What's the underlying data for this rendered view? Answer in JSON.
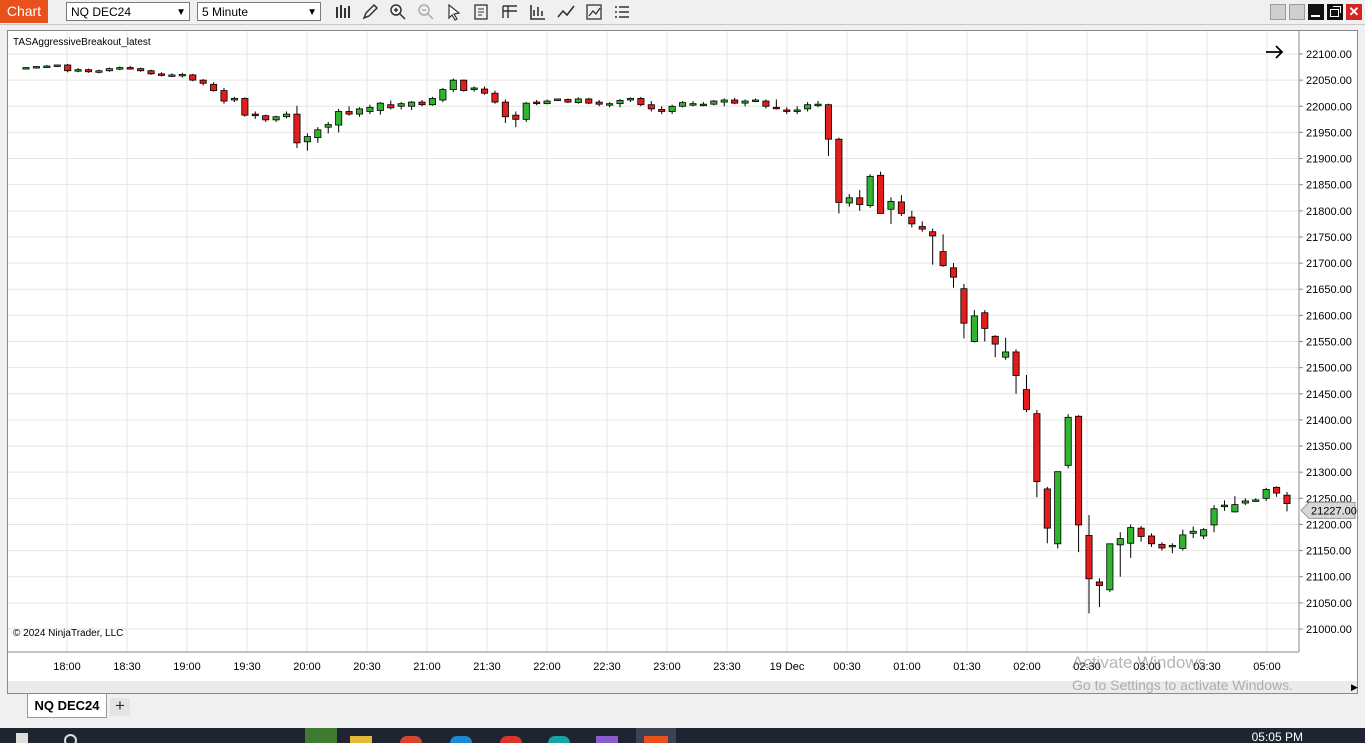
{
  "toolbar": {
    "chart_label": "Chart",
    "instrument": "NQ DEC24",
    "interval": "5 Minute",
    "icons": [
      "bar-type-icon",
      "draw-pencil-icon",
      "zoom-in-icon",
      "zoom-out-icon",
      "pointer-icon",
      "data-box-icon",
      "templates-icon",
      "properties-icon",
      "indicators-icon",
      "strategies-icon",
      "more-menu-icon"
    ]
  },
  "chart": {
    "strategy_label": "TASAggressiveBreakout_latest",
    "copyright": "© 2024 NinjaTrader, LLC",
    "current_price_label": "21227.00",
    "y_ticks": [
      "22100.00",
      "22050.00",
      "22000.00",
      "21950.00",
      "21900.00",
      "21850.00",
      "21800.00",
      "21750.00",
      "21700.00",
      "21650.00",
      "21600.00",
      "21550.00",
      "21500.00",
      "21450.00",
      "21400.00",
      "21350.00",
      "21300.00",
      "21250.00",
      "21200.00",
      "21150.00",
      "21100.00",
      "21050.00",
      "21000.00"
    ],
    "x_ticks": [
      "18:00",
      "18:30",
      "19:00",
      "19:30",
      "20:00",
      "20:30",
      "21:00",
      "21:30",
      "22:00",
      "22:30",
      "23:00",
      "23:30",
      "19 Dec",
      "00:30",
      "01:00",
      "01:30",
      "02:00",
      "02:30",
      "03:00",
      "03:30",
      "05:00"
    ],
    "colors": {
      "up": "#2fb52f",
      "down": "#e31c1c",
      "grid": "#e6e6e6",
      "accent": "#e8501c"
    }
  },
  "chart_data": {
    "type": "candlestick",
    "instrument": "NQ DEC24",
    "interval": "5 Minute",
    "ylim": [
      20980,
      22120
    ],
    "candles": [
      [
        22073,
        22075,
        22071,
        22074
      ],
      [
        22074,
        22077,
        22072,
        22076
      ],
      [
        22076,
        22079,
        22074,
        22077
      ],
      [
        22078,
        22080,
        22075,
        22079
      ],
      [
        22079,
        22081,
        22065,
        22068
      ],
      [
        22069,
        22073,
        22065,
        22070
      ],
      [
        22070,
        22072,
        22064,
        22066
      ],
      [
        22065,
        22070,
        22063,
        22068
      ],
      [
        22068,
        22074,
        22066,
        22072
      ],
      [
        22071,
        22076,
        22069,
        22074
      ],
      [
        22074,
        22077,
        22070,
        22072
      ],
      [
        22072,
        22074,
        22066,
        22068
      ],
      [
        22068,
        22070,
        22060,
        22062
      ],
      [
        22062,
        22065,
        22057,
        22059
      ],
      [
        22059,
        22063,
        22056,
        22060
      ],
      [
        22060,
        22064,
        22055,
        22061
      ],
      [
        22060,
        22062,
        22048,
        22050
      ],
      [
        22050,
        22052,
        22040,
        22044
      ],
      [
        22042,
        22046,
        22028,
        22030
      ],
      [
        22030,
        22035,
        22005,
        22010
      ],
      [
        22012,
        22018,
        22008,
        22015
      ],
      [
        22015,
        22017,
        21980,
        21983
      ],
      [
        21985,
        21990,
        21976,
        21982
      ],
      [
        21982,
        21984,
        21970,
        21974
      ],
      [
        21974,
        21982,
        21970,
        21980
      ],
      [
        21980,
        21990,
        21977,
        21985
      ],
      [
        21985,
        22001,
        21920,
        21930
      ],
      [
        21932,
        21948,
        21915,
        21942
      ],
      [
        21940,
        21960,
        21930,
        21955
      ],
      [
        21960,
        21970,
        21948,
        21965
      ],
      [
        21964,
        21995,
        21950,
        21990
      ],
      [
        21990,
        22000,
        21982,
        21985
      ],
      [
        21985,
        21998,
        21980,
        21995
      ],
      [
        21990,
        22003,
        21985,
        21998
      ],
      [
        21992,
        22008,
        21984,
        22006
      ],
      [
        22003,
        22011,
        21994,
        21997
      ],
      [
        22000,
        22008,
        21994,
        22005
      ],
      [
        22000,
        22010,
        21993,
        22008
      ],
      [
        22008,
        22012,
        22000,
        22003
      ],
      [
        22003,
        22018,
        22001,
        22015
      ],
      [
        22012,
        22035,
        22008,
        22032
      ],
      [
        22032,
        22053,
        22027,
        22050
      ],
      [
        22050,
        22051,
        22028,
        22030
      ],
      [
        22032,
        22038,
        22028,
        22035
      ],
      [
        22033,
        22038,
        22022,
        22025
      ],
      [
        22025,
        22030,
        22005,
        22008
      ],
      [
        22008,
        22013,
        21968,
        21980
      ],
      [
        21983,
        21990,
        21960,
        21975
      ],
      [
        21975,
        22008,
        21970,
        22006
      ],
      [
        22008,
        22012,
        22002,
        22005
      ],
      [
        22005,
        22013,
        22004,
        22010
      ],
      [
        22011,
        22015,
        22010,
        22014
      ],
      [
        22013,
        22015,
        22006,
        22008
      ],
      [
        22007,
        22017,
        22005,
        22014
      ],
      [
        22014,
        22016,
        22004,
        22006
      ],
      [
        22008,
        22012,
        22000,
        22004
      ],
      [
        22004,
        22008,
        21998,
        22005
      ],
      [
        22005,
        22014,
        21998,
        22011
      ],
      [
        22012,
        22017,
        22008,
        22015
      ],
      [
        22015,
        22018,
        22000,
        22003
      ],
      [
        22003,
        22010,
        21990,
        21995
      ],
      [
        21994,
        22000,
        21985,
        21990
      ],
      [
        21990,
        22003,
        21985,
        22000
      ],
      [
        22000,
        22010,
        21998,
        22007
      ],
      [
        22005,
        22010,
        22000,
        22005
      ],
      [
        22003,
        22008,
        22000,
        22004
      ],
      [
        22004,
        22012,
        22002,
        22010
      ],
      [
        22008,
        22015,
        22000,
        22012
      ],
      [
        22012,
        22016,
        22004,
        22006
      ],
      [
        22006,
        22013,
        22000,
        22010
      ],
      [
        22012,
        22015,
        22008,
        22012
      ],
      [
        22010,
        22013,
        21996,
        22000
      ],
      [
        21998,
        22013,
        21994,
        21997
      ],
      [
        21993,
        21998,
        21985,
        21990
      ],
      [
        21990,
        22000,
        21985,
        21993
      ],
      [
        21995,
        22008,
        21990,
        22003
      ],
      [
        22003,
        22010,
        21998,
        22004
      ],
      [
        22003,
        22005,
        21905,
        21937
      ],
      [
        21937,
        21940,
        21795,
        21816
      ],
      [
        21815,
        21832,
        21808,
        21825
      ],
      [
        21825,
        21840,
        21800,
        21812
      ],
      [
        21810,
        21870,
        21806,
        21866
      ],
      [
        21868,
        21875,
        21810,
        21795
      ],
      [
        21803,
        21826,
        21775,
        21818
      ],
      [
        21817,
        21830,
        21790,
        21795
      ],
      [
        21788,
        21800,
        21768,
        21775
      ],
      [
        21770,
        21780,
        21760,
        21765
      ],
      [
        21760,
        21766,
        21697,
        21752
      ],
      [
        21722,
        21755,
        21693,
        21695
      ],
      [
        21691,
        21700,
        21653,
        21673
      ],
      [
        21651,
        21660,
        21556,
        21585
      ],
      [
        21550,
        21610,
        21548,
        21599
      ],
      [
        21605,
        21610,
        21550,
        21575
      ],
      [
        21560,
        21562,
        21520,
        21545
      ],
      [
        21520,
        21557,
        21515,
        21530
      ],
      [
        21530,
        21535,
        21450,
        21485
      ],
      [
        21458,
        21486,
        21415,
        21420
      ],
      [
        21412,
        21419,
        21252,
        21282
      ],
      [
        21268,
        21272,
        21164,
        21193
      ],
      [
        21163,
        21290,
        21154,
        21301
      ],
      [
        21313,
        21411,
        21307,
        21405
      ],
      [
        21407,
        21409,
        21147,
        21199
      ],
      [
        21179,
        21218,
        21030,
        21096
      ],
      [
        21090,
        21097,
        21042,
        21083
      ],
      [
        21075,
        21160,
        21071,
        21163
      ],
      [
        21161,
        21185,
        21100,
        21173
      ],
      [
        21164,
        21200,
        21136,
        21194
      ],
      [
        21193,
        21197,
        21167,
        21177
      ],
      [
        21178,
        21183,
        21157,
        21163
      ],
      [
        21162,
        21166,
        21150,
        21155
      ],
      [
        21158,
        21164,
        21145,
        21160
      ],
      [
        21154,
        21190,
        21150,
        21180
      ],
      [
        21183,
        21196,
        21174,
        21187
      ],
      [
        21178,
        21193,
        21172,
        21190
      ],
      [
        21199,
        21237,
        21185,
        21230
      ],
      [
        21234,
        21246,
        21226,
        21237
      ],
      [
        21224,
        21254,
        21223,
        21238
      ],
      [
        21241,
        21250,
        21237,
        21245
      ],
      [
        21245,
        21250,
        21243,
        21247
      ],
      [
        21250,
        21270,
        21245,
        21267
      ],
      [
        21271,
        21273,
        21253,
        21260
      ],
      [
        21256,
        21262,
        21225,
        21240
      ]
    ]
  },
  "tabs": {
    "active": "NQ DEC24",
    "add": "+"
  },
  "watermark": {
    "line1": "Activate Windows",
    "line2": "Go to Settings to activate Windows."
  },
  "taskbar": {
    "time": "05:05 PM"
  }
}
